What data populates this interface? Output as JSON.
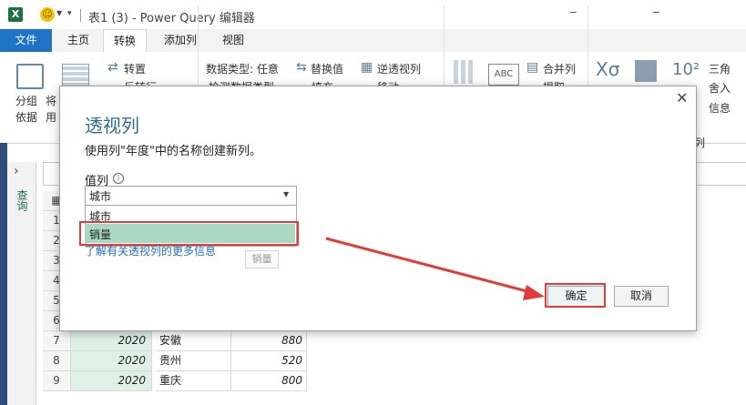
{
  "titlebar": {
    "app_letter": "X",
    "title": "表1 (3) - Power Query 编辑器",
    "dash1": "_",
    "dash2": "_"
  },
  "tabs": {
    "file": "文件",
    "home": "主页",
    "transform": "转换",
    "addcol": "添加列",
    "view": "视图"
  },
  "ribbon": {
    "group_by": "分组\n依据",
    "use_first": "将\n用",
    "transpose": "转置",
    "reverse": "反转行",
    "datatype": "数据类型: 任意",
    "replace": "替换值",
    "unpivot": "逆透视列",
    "detect": "检测数据类型",
    "fill": "填充",
    "move": "移动",
    "merge_cols": "合并列",
    "extract": "提取",
    "triangle": "三角",
    "round": "舍入",
    "info": "信息",
    "column_text": "列",
    "abc": "ABC"
  },
  "side": {
    "query_label": "查询"
  },
  "grid": {
    "header_icon": "▦",
    "rows": [
      {
        "n": "1",
        "year": "",
        "city": "",
        "val": ""
      },
      {
        "n": "2",
        "year": "",
        "city": "",
        "val": ""
      },
      {
        "n": "3",
        "year": "",
        "city": "",
        "val": ""
      },
      {
        "n": "4",
        "year": "",
        "city": "",
        "val": ""
      },
      {
        "n": "5",
        "year": "",
        "city": "",
        "val": ""
      },
      {
        "n": "6",
        "year": "",
        "city": "",
        "val": ""
      },
      {
        "n": "7",
        "year": "2020",
        "city": "安徽",
        "val": "880"
      },
      {
        "n": "8",
        "year": "2020",
        "city": "贵州",
        "val": "520"
      },
      {
        "n": "9",
        "year": "2020",
        "city": "重庆",
        "val": "800"
      }
    ]
  },
  "dialog": {
    "title": "透视列",
    "description": "使用列\"年度\"中的名称创建新列。",
    "value_label": "值列",
    "info_glyph": "i",
    "selected": "城市",
    "options": [
      "城市",
      "销量"
    ],
    "learn_more": "了解有关透视列的更多信息",
    "tooltip": "销量",
    "ok": "确定",
    "cancel": "取消",
    "close": "✕"
  },
  "colors": {
    "accent": "#2074c8",
    "highlight": "#e23b3b",
    "selected_option": "#a9d9c2",
    "excel_green": "#1e7145"
  }
}
